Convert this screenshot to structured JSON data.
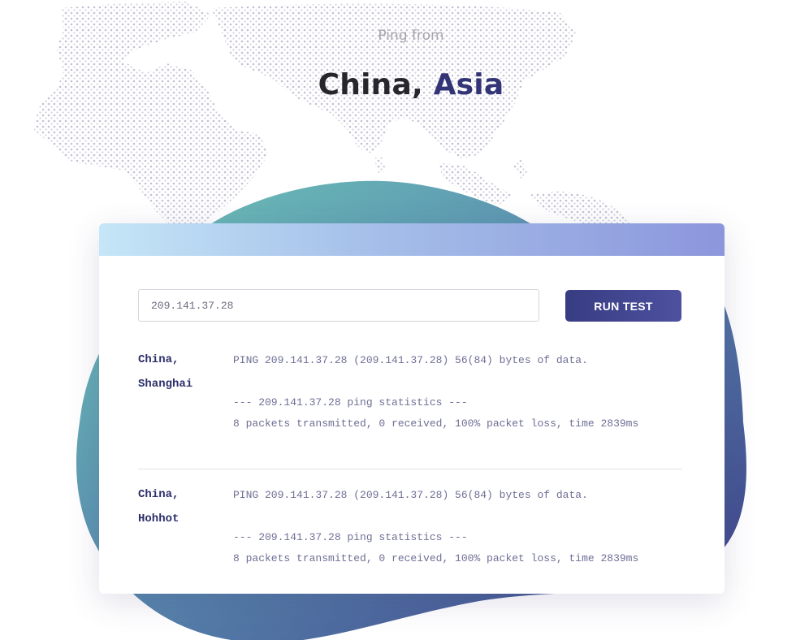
{
  "hero": {
    "subtitle": "Ping from",
    "title_country": "China,",
    "title_region": "Asia"
  },
  "form": {
    "ip_value": "209.141.37.28",
    "run_button_label": "RUN TEST"
  },
  "results": [
    {
      "location_line1": "China,",
      "location_line2": "Shanghai",
      "ping_header": "PING 209.141.37.28 (209.141.37.28) 56(84) bytes of data.",
      "stats_header": "--- 209.141.37.28 ping statistics ---",
      "stats_summary": "8 packets transmitted, 0 received, 100% packet loss, time 2839ms"
    },
    {
      "location_line1": "China,",
      "location_line2": "Hohhot",
      "ping_header": "PING 209.141.37.28 (209.141.37.28) 56(84) bytes of data.",
      "stats_header": "--- 209.141.37.28 ping statistics ---",
      "stats_summary": "8 packets transmitted, 0 received, 100% packet loss, time 2839ms"
    }
  ],
  "colors": {
    "accent": "#333477",
    "button": "#3d4088",
    "blob_start": "#6ec7b8",
    "blob_end": "#3c3b87",
    "header_start": "#c5e6f7",
    "header_end": "#8c96dc"
  }
}
